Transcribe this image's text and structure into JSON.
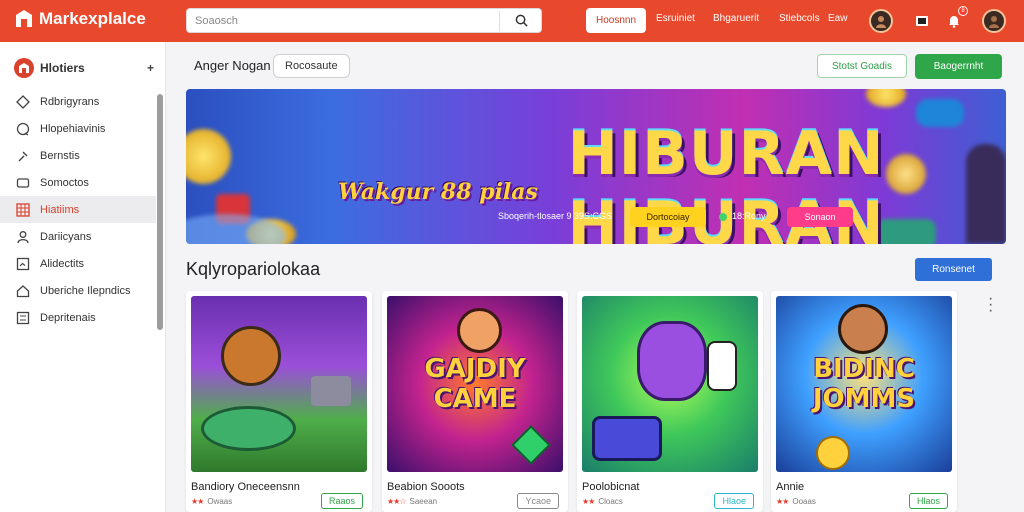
{
  "app": {
    "logo_text": "Markexplalce"
  },
  "search": {
    "placeholder": "Soaosch"
  },
  "topnav": {
    "primary_button": "Hoosnnn",
    "links": [
      "Esruiniet",
      "Bhgaruerit",
      "Stiebcols",
      "Eaw"
    ],
    "notification_count": "8"
  },
  "sidebar": {
    "header": "Hlotiers",
    "items": [
      {
        "label": "Rdbrigyrans",
        "icon": "diamond-icon"
      },
      {
        "label": "Hlopehiavinis",
        "icon": "chat-icon"
      },
      {
        "label": "Bernstis",
        "icon": "pin-icon"
      },
      {
        "label": "Somoctos",
        "icon": "monitor-icon"
      },
      {
        "label": "Hiatiims",
        "icon": "grid-icon",
        "active": true
      },
      {
        "label": "Dariicyans",
        "icon": "user-icon"
      },
      {
        "label": "Alidectits",
        "icon": "chart-icon"
      },
      {
        "label": "Uberiche Ilepndics",
        "icon": "home-icon"
      },
      {
        "label": "Depritenais",
        "icon": "list-icon"
      }
    ]
  },
  "main": {
    "label": "Anger Nogan",
    "chip": "Rocosaute",
    "outline_button": "Stotst Goadis",
    "green_button": "Baogerrnht"
  },
  "banner": {
    "title": "HIBURAN HIBURAN",
    "subtitle": "Wakgur 88 pilas",
    "meta_text": "Sboqerih-tlosaer 9 39S:CGS",
    "yellow_button": "Dortocoiay",
    "meta_text2": "18:Rony",
    "pink_button": "Sonaon"
  },
  "section": {
    "title": "Kqlyropariolokaa",
    "button": "Ronsenet"
  },
  "cards": [
    {
      "name": "Bandiory Oneceensnn",
      "rating_text": "Owaas",
      "stars": "★★",
      "pill": "Raaos",
      "pill_color": "#2fa649",
      "thumb_text": ""
    },
    {
      "name": "Beabion Sooots",
      "rating_text": "Saeean",
      "stars": "★★☆",
      "pill": "Ycaoe",
      "pill_color": "#888888",
      "thumb_text": "GAJDIY CAME"
    },
    {
      "name": "Poolobicnat",
      "rating_text": "Cloacs",
      "stars": "★★",
      "pill": "Hlaoe",
      "pill_color": "#2bb6c9",
      "thumb_text": ""
    },
    {
      "name": "Annie",
      "rating_text": "Ooaas",
      "stars": "★★",
      "pill": "Hlaos",
      "pill_color": "#2fa649",
      "thumb_text": "BIDINC JOMMS"
    }
  ],
  "colors": {
    "topbar": "#e8482c",
    "accent_green": "#2fa649",
    "accent_blue": "#2f6fd8"
  }
}
